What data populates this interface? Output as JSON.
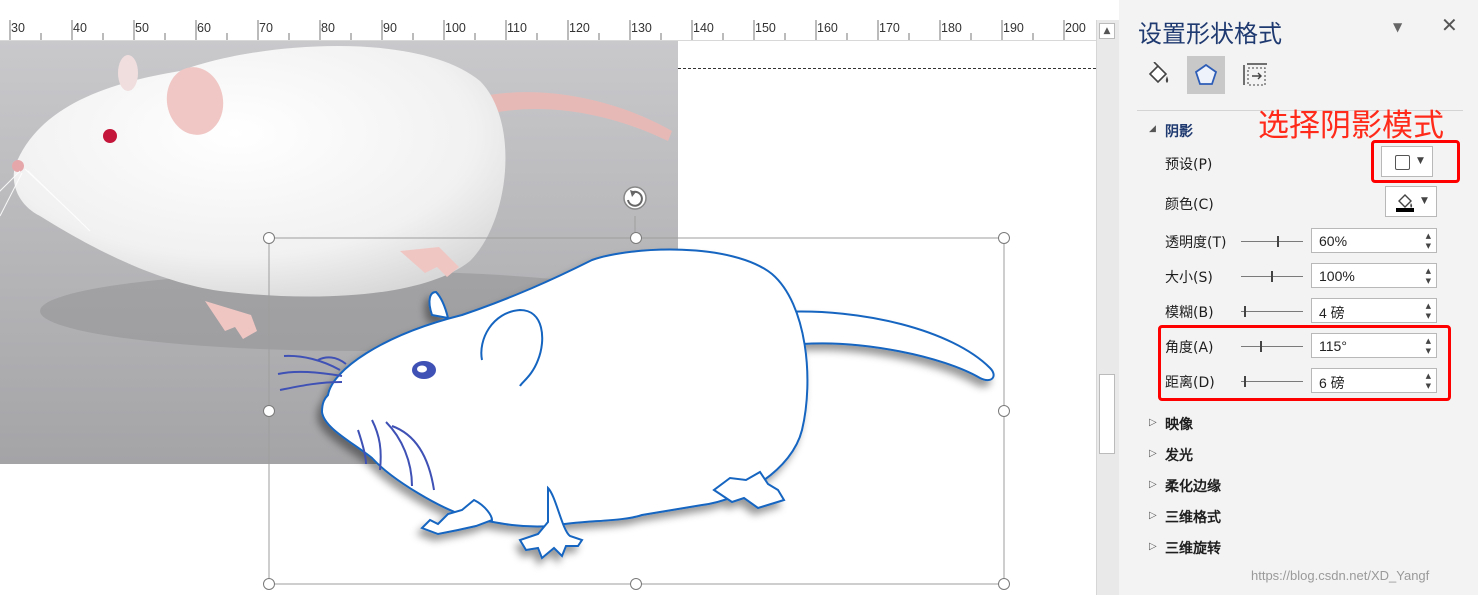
{
  "ruler": {
    "labels": [
      "30",
      "40",
      "50",
      "60",
      "70",
      "80",
      "90",
      "100",
      "110",
      "120",
      "130",
      "140",
      "150",
      "160",
      "170",
      "180",
      "190",
      "200"
    ]
  },
  "pane": {
    "title": "设置形状格式",
    "shadow": {
      "header": "阴影",
      "preset_label": "预设(P)",
      "color_label": "颜色(C)",
      "transparency": {
        "label": "透明度(T)",
        "value": "60%",
        "level": 0.6
      },
      "size": {
        "label": "大小(S)",
        "value": "100%",
        "level": 0.5
      },
      "blur": {
        "label": "模糊(B)",
        "value": "4 磅",
        "level": 0.05
      },
      "angle": {
        "label": "角度(A)",
        "value": "115°",
        "level": 0.32
      },
      "distance": {
        "label": "距离(D)",
        "value": "6 磅",
        "level": 0.05
      }
    },
    "sections": [
      "映像",
      "发光",
      "柔化边缘",
      "三维格式",
      "三维旋转"
    ],
    "accent_color": "#1f3a70"
  },
  "annotation": "选择阴影模式",
  "watermark": "https://blog.csdn.net/XD_Yangf",
  "colors": {
    "highlight": "#ff0000",
    "outline": "#1565c0"
  }
}
